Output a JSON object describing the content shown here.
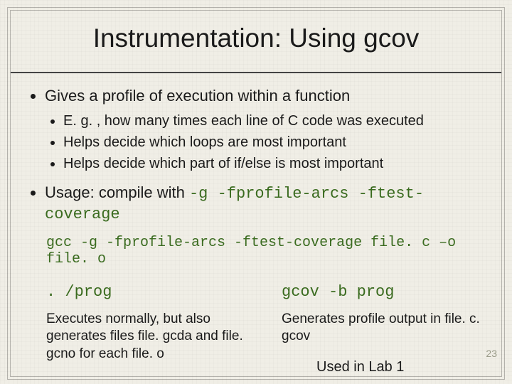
{
  "title": "Instrumentation: Using gcov",
  "bullets": {
    "main1": "Gives a profile of execution within a function",
    "sub1": "E. g. , how many times each line of C code was executed",
    "sub2": "Helps decide which loops are most important",
    "sub3": "Helps decide which part of if/else is most important",
    "main2_prefix": "Usage: compile with ",
    "main2_code": "-g -fprofile-arcs -ftest-coverage"
  },
  "cmd": "gcc -g -fprofile-arcs -ftest-coverage file. c –o file. o",
  "left": {
    "heading": ". /prog",
    "text": "Executes normally, but also generates files file. gcda and file. gcno for each file. o"
  },
  "right": {
    "heading": "gcov -b prog",
    "text": "Generates profile output in file. c. gcov"
  },
  "lab_note": "Used in Lab 1",
  "page_number": "23"
}
